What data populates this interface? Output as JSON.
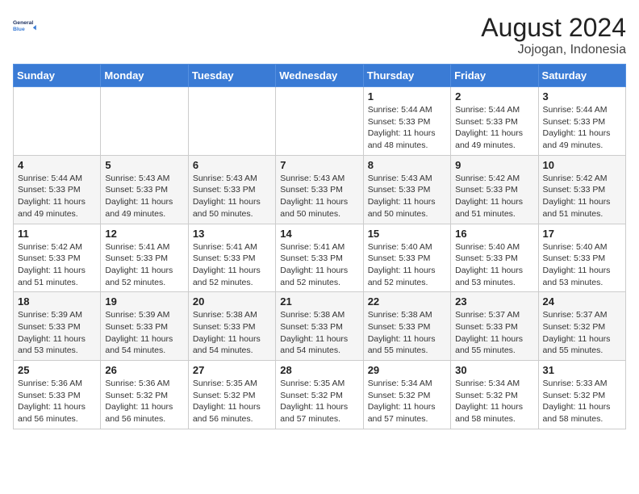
{
  "header": {
    "logo_line1": "General",
    "logo_line2": "Blue",
    "month_year": "August 2024",
    "location": "Jojogan, Indonesia"
  },
  "weekdays": [
    "Sunday",
    "Monday",
    "Tuesday",
    "Wednesday",
    "Thursday",
    "Friday",
    "Saturday"
  ],
  "weeks": [
    [
      {
        "day": "",
        "info": ""
      },
      {
        "day": "",
        "info": ""
      },
      {
        "day": "",
        "info": ""
      },
      {
        "day": "",
        "info": ""
      },
      {
        "day": "1",
        "info": "Sunrise: 5:44 AM\nSunset: 5:33 PM\nDaylight: 11 hours\nand 48 minutes."
      },
      {
        "day": "2",
        "info": "Sunrise: 5:44 AM\nSunset: 5:33 PM\nDaylight: 11 hours\nand 49 minutes."
      },
      {
        "day": "3",
        "info": "Sunrise: 5:44 AM\nSunset: 5:33 PM\nDaylight: 11 hours\nand 49 minutes."
      }
    ],
    [
      {
        "day": "4",
        "info": "Sunrise: 5:44 AM\nSunset: 5:33 PM\nDaylight: 11 hours\nand 49 minutes."
      },
      {
        "day": "5",
        "info": "Sunrise: 5:43 AM\nSunset: 5:33 PM\nDaylight: 11 hours\nand 49 minutes."
      },
      {
        "day": "6",
        "info": "Sunrise: 5:43 AM\nSunset: 5:33 PM\nDaylight: 11 hours\nand 50 minutes."
      },
      {
        "day": "7",
        "info": "Sunrise: 5:43 AM\nSunset: 5:33 PM\nDaylight: 11 hours\nand 50 minutes."
      },
      {
        "day": "8",
        "info": "Sunrise: 5:43 AM\nSunset: 5:33 PM\nDaylight: 11 hours\nand 50 minutes."
      },
      {
        "day": "9",
        "info": "Sunrise: 5:42 AM\nSunset: 5:33 PM\nDaylight: 11 hours\nand 51 minutes."
      },
      {
        "day": "10",
        "info": "Sunrise: 5:42 AM\nSunset: 5:33 PM\nDaylight: 11 hours\nand 51 minutes."
      }
    ],
    [
      {
        "day": "11",
        "info": "Sunrise: 5:42 AM\nSunset: 5:33 PM\nDaylight: 11 hours\nand 51 minutes."
      },
      {
        "day": "12",
        "info": "Sunrise: 5:41 AM\nSunset: 5:33 PM\nDaylight: 11 hours\nand 52 minutes."
      },
      {
        "day": "13",
        "info": "Sunrise: 5:41 AM\nSunset: 5:33 PM\nDaylight: 11 hours\nand 52 minutes."
      },
      {
        "day": "14",
        "info": "Sunrise: 5:41 AM\nSunset: 5:33 PM\nDaylight: 11 hours\nand 52 minutes."
      },
      {
        "day": "15",
        "info": "Sunrise: 5:40 AM\nSunset: 5:33 PM\nDaylight: 11 hours\nand 52 minutes."
      },
      {
        "day": "16",
        "info": "Sunrise: 5:40 AM\nSunset: 5:33 PM\nDaylight: 11 hours\nand 53 minutes."
      },
      {
        "day": "17",
        "info": "Sunrise: 5:40 AM\nSunset: 5:33 PM\nDaylight: 11 hours\nand 53 minutes."
      }
    ],
    [
      {
        "day": "18",
        "info": "Sunrise: 5:39 AM\nSunset: 5:33 PM\nDaylight: 11 hours\nand 53 minutes."
      },
      {
        "day": "19",
        "info": "Sunrise: 5:39 AM\nSunset: 5:33 PM\nDaylight: 11 hours\nand 54 minutes."
      },
      {
        "day": "20",
        "info": "Sunrise: 5:38 AM\nSunset: 5:33 PM\nDaylight: 11 hours\nand 54 minutes."
      },
      {
        "day": "21",
        "info": "Sunrise: 5:38 AM\nSunset: 5:33 PM\nDaylight: 11 hours\nand 54 minutes."
      },
      {
        "day": "22",
        "info": "Sunrise: 5:38 AM\nSunset: 5:33 PM\nDaylight: 11 hours\nand 55 minutes."
      },
      {
        "day": "23",
        "info": "Sunrise: 5:37 AM\nSunset: 5:33 PM\nDaylight: 11 hours\nand 55 minutes."
      },
      {
        "day": "24",
        "info": "Sunrise: 5:37 AM\nSunset: 5:32 PM\nDaylight: 11 hours\nand 55 minutes."
      }
    ],
    [
      {
        "day": "25",
        "info": "Sunrise: 5:36 AM\nSunset: 5:33 PM\nDaylight: 11 hours\nand 56 minutes."
      },
      {
        "day": "26",
        "info": "Sunrise: 5:36 AM\nSunset: 5:32 PM\nDaylight: 11 hours\nand 56 minutes."
      },
      {
        "day": "27",
        "info": "Sunrise: 5:35 AM\nSunset: 5:32 PM\nDaylight: 11 hours\nand 56 minutes."
      },
      {
        "day": "28",
        "info": "Sunrise: 5:35 AM\nSunset: 5:32 PM\nDaylight: 11 hours\nand 57 minutes."
      },
      {
        "day": "29",
        "info": "Sunrise: 5:34 AM\nSunset: 5:32 PM\nDaylight: 11 hours\nand 57 minutes."
      },
      {
        "day": "30",
        "info": "Sunrise: 5:34 AM\nSunset: 5:32 PM\nDaylight: 11 hours\nand 58 minutes."
      },
      {
        "day": "31",
        "info": "Sunrise: 5:33 AM\nSunset: 5:32 PM\nDaylight: 11 hours\nand 58 minutes."
      }
    ]
  ]
}
